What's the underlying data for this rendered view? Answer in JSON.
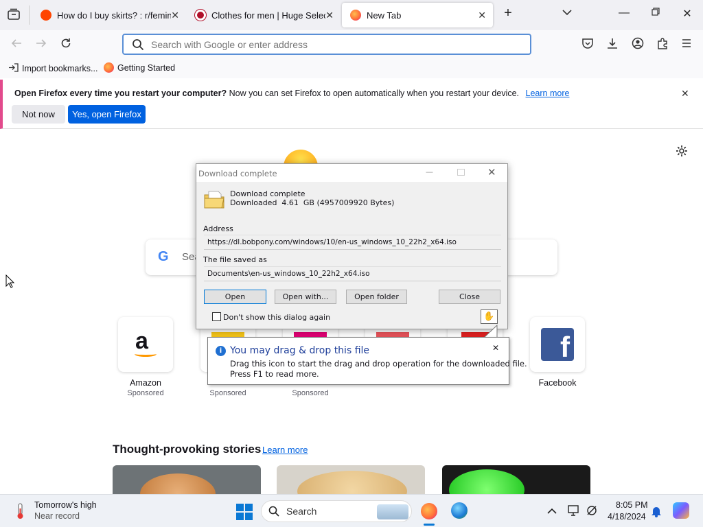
{
  "tabs": [
    {
      "title": "How do I buy skirts? : r/feminin",
      "icon": "reddit-icon",
      "color": "#ff4500"
    },
    {
      "title": "Clothes for men | Huge Selectio",
      "icon": "shop-icon",
      "color": "#b0102a"
    },
    {
      "title": "New Tab",
      "icon": "firefox-icon",
      "color": "#ff7139"
    }
  ],
  "url_bar": {
    "placeholder": "Search with Google or enter address"
  },
  "bookmarks": [
    {
      "label": "Import bookmarks..."
    },
    {
      "label": "Getting Started"
    }
  ],
  "notification": {
    "bold": "Open Firefox every time you restart your computer?",
    "text": " Now you can set Firefox to open automatically when you restart your device.",
    "learn_more": "Learn more",
    "not_now": "Not now",
    "yes": "Yes, open Firefox",
    "accent": "#e24a8c"
  },
  "search": {
    "placeholder": "Sea"
  },
  "shortcuts": [
    {
      "label": "Amazon",
      "sponsored": "Sponsored"
    },
    {
      "label": "",
      "sponsored": "Sponsored"
    },
    {
      "label": "",
      "sponsored": "Sponsored"
    },
    {
      "label": "Facebook",
      "sponsored": ""
    }
  ],
  "stories": {
    "heading": "Thought-provoking stories",
    "learn_more": "Learn more"
  },
  "dialog": {
    "title": "Download complete",
    "heading": "Download complete",
    "subheading": "Downloaded  4.61  GB (4957009920 Bytes)",
    "address_label": "Address",
    "address_value": "https://dl.bobpony.com/windows/10/en-us_windows_10_22h2_x64.iso",
    "saved_label": "The file saved as",
    "saved_value": "Documents\\en-us_windows_10_22h2_x64.iso",
    "open": "Open",
    "open_with": "Open with...",
    "open_folder": "Open folder",
    "close": "Close",
    "dont_show": "Don't show this dialog again"
  },
  "tooltip": {
    "title": "You may drag & drop this file",
    "line1": "Drag this icon to start the drag and drop operation for the downloaded file.",
    "line2": "Press F1 to read more."
  },
  "taskbar": {
    "weather_title": "Tomorrow's high",
    "weather_sub": "Near record",
    "search": "Search",
    "time": "8:05 PM",
    "date": "4/18/2024"
  }
}
